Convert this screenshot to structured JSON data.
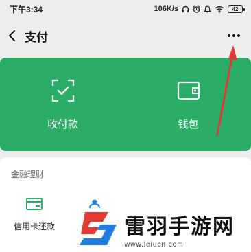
{
  "status_bar": {
    "time": "下午3:34",
    "network_speed": "106K/s",
    "battery_level": "42",
    "icons": [
      "headphone-icon",
      "alarm-icon",
      "ring-icon",
      "wifi-icon",
      "battery-icon"
    ]
  },
  "nav": {
    "back_icon": "chevron-left-icon",
    "title": "支付",
    "more_icon": "more-icon"
  },
  "pay_card": {
    "color": "#2aae67",
    "items": [
      {
        "label": "收付款",
        "icon": "scan-check-icon"
      },
      {
        "label": "钱包",
        "icon": "wallet-icon"
      }
    ]
  },
  "finance": {
    "title": "金融理财",
    "items": [
      {
        "label": "信用卡还款",
        "icon": "credit-card-icon",
        "color": "#2aae67"
      },
      {
        "label": "",
        "icon": "finance-icon",
        "color": "#1e7fe0"
      }
    ]
  },
  "annotation": {
    "arrow_color": "#e53935"
  },
  "watermark": {
    "name": "雷羽手游网",
    "url": "www.leiucn.com",
    "logo_colors": [
      "#e53935",
      "#1e7fe0"
    ]
  }
}
